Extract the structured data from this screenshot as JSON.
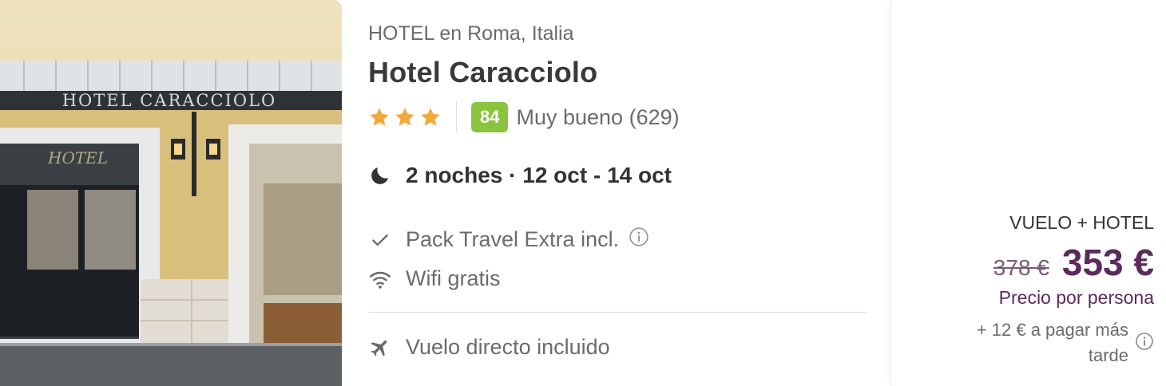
{
  "hotel": {
    "location": "HOTEL en Roma, Italia",
    "name": "Hotel Caracciolo",
    "stars": 3,
    "score": "84",
    "score_text": "Muy bueno (629)",
    "facade_sign": "HOTEL CARACCIOLO"
  },
  "stay": {
    "nights": "2 noches · 12 oct - 14 oct"
  },
  "features": [
    {
      "icon": "check-icon",
      "label": "Pack Travel Extra incl."
    },
    {
      "icon": "wifi-icon",
      "label": "Wifi gratis"
    },
    {
      "icon": "plane-icon",
      "label": "Vuelo directo incluido"
    }
  ],
  "price": {
    "package": "VUELO + HOTEL",
    "old": "378 €",
    "current": "353 €",
    "per_person": "Precio por persona",
    "extra": "+ 12 € a pagar más tarde"
  },
  "colors": {
    "score_badge": "#8ac43f",
    "star": "#f2a93b",
    "price": "#5c2a5c"
  }
}
